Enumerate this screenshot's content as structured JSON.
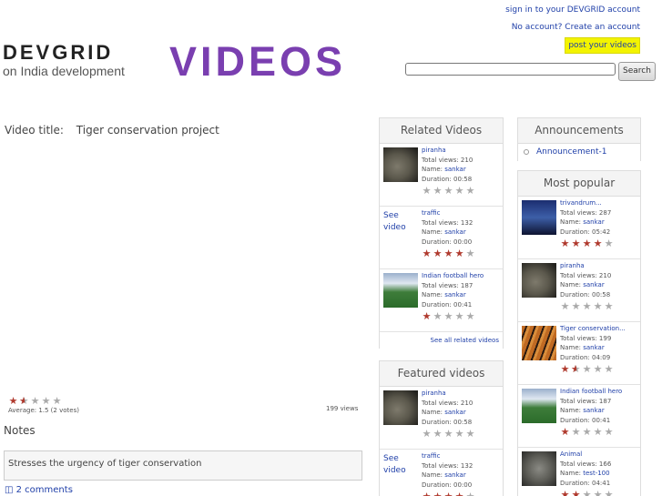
{
  "topnav": {
    "sign_in": "sign in to your DEVGRID account",
    "create": "No account? Create an account",
    "post": "post your videos"
  },
  "logo": {
    "brand": "DEVGRID",
    "tagline": "on India development",
    "section": "VIDEOS"
  },
  "search": {
    "button": "Search",
    "value": ""
  },
  "video": {
    "title_label": "Video title:",
    "title": "Tiger conservation project",
    "rating": 1.5,
    "avg_text": "Average: 1.5 (2 votes)",
    "views_text": "199 views",
    "notes_heading": "Notes",
    "notes_text": "Stresses the urgency of tiger conservation",
    "comments": "2 comments"
  },
  "related": {
    "heading": "Related Videos",
    "items": [
      {
        "title": "piranha",
        "views": "Total views: 210",
        "name_label": "Name:",
        "name": "sankar",
        "duration": "Duration: 00:58",
        "rating": 0,
        "thumb": "fish"
      },
      {
        "see": "See video",
        "title": "traffic",
        "views": "Total views: 132",
        "name_label": "Name:",
        "name": "sankar",
        "duration": "Duration: 00:00",
        "rating": 4
      },
      {
        "title": "Indian football hero",
        "views": "Total views: 187",
        "name_label": "Name:",
        "name": "sankar",
        "duration": "Duration: 00:41",
        "rating": 1,
        "thumb": "football"
      }
    ],
    "see_all": "See all related videos"
  },
  "featured": {
    "heading": "Featured videos",
    "items": [
      {
        "title": "piranha",
        "views": "Total views: 210",
        "name_label": "Name:",
        "name": "sankar",
        "duration": "Duration: 00:58",
        "rating": 0,
        "thumb": "fish"
      },
      {
        "see": "See video",
        "title": "traffic",
        "views": "Total views: 132",
        "name_label": "Name:",
        "name": "sankar",
        "duration": "Duration: 00:00",
        "rating": 4
      }
    ]
  },
  "announcements": {
    "heading": "Announcements",
    "items": [
      "Announcement-1"
    ]
  },
  "popular": {
    "heading": "Most popular",
    "items": [
      {
        "title": "trivandrum...",
        "views": "Total views: 287",
        "name_label": "Name:",
        "name": "sankar",
        "duration": "Duration: 05:42",
        "rating": 4,
        "thumb": "city"
      },
      {
        "title": "piranha",
        "views": "Total views: 210",
        "name_label": "Name:",
        "name": "sankar",
        "duration": "Duration: 00:58",
        "rating": 0,
        "thumb": "fish"
      },
      {
        "title": "Tiger conservation...",
        "views": "Total views: 199",
        "name_label": "Name:",
        "name": "sankar",
        "duration": "Duration: 04:09",
        "rating": 1.5,
        "thumb": "tiger"
      },
      {
        "title": "Indian football hero",
        "views": "Total views: 187",
        "name_label": "Name:",
        "name": "sankar",
        "duration": "Duration: 00:41",
        "rating": 1,
        "thumb": "football"
      },
      {
        "title": "Animal",
        "views": "Total views: 166",
        "name_label": "Name:",
        "name": "test-100",
        "duration": "Duration: 04:41",
        "rating": 2,
        "thumb": "animal"
      }
    ]
  },
  "colors": {
    "link": "#1f3fa8",
    "star": "#b03a2e",
    "post_bg": "#f3f300",
    "videos_logo": "#7a3fb0"
  }
}
